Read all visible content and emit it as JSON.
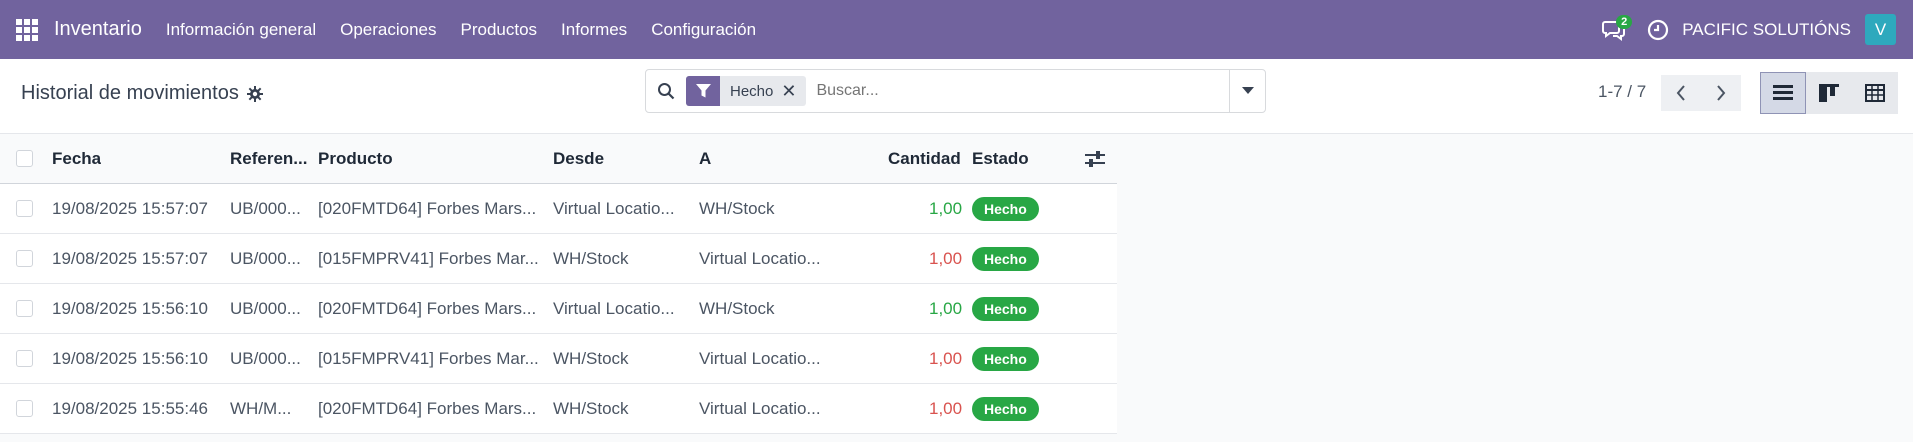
{
  "navbar": {
    "brand": "Inventario",
    "menu": [
      "Información general",
      "Operaciones",
      "Productos",
      "Informes",
      "Configuración"
    ],
    "chat_count": "2",
    "company": "PACIFIC SOLUTIÓNS",
    "avatar_letter": "V",
    "color": "#71639e"
  },
  "control": {
    "title": "Historial de movimientos",
    "facet_label": "Hecho",
    "facet_close": "✕",
    "search_placeholder": "Buscar...",
    "pager": "1-7 / 7"
  },
  "table": {
    "headers": {
      "fecha": "Fecha",
      "referencia": "Referen...",
      "producto": "Producto",
      "desde": "Desde",
      "a": "A",
      "cantidad": "Cantidad",
      "estado": "Estado"
    },
    "rows": [
      {
        "fecha": "19/08/2025 15:57:07",
        "referencia": "UB/000...",
        "producto": "[020FMTD64] Forbes Mars...",
        "desde": "Virtual Locatio...",
        "a": "WH/Stock",
        "cantidad": "1,00",
        "estado": "Hecho"
      },
      {
        "fecha": "19/08/2025 15:57:07",
        "referencia": "UB/000...",
        "producto": "[015FMPRV41] Forbes Mar...",
        "desde": "WH/Stock",
        "a": "Virtual Locatio...",
        "cantidad": "1,00",
        "estado": "Hecho"
      },
      {
        "fecha": "19/08/2025 15:56:10",
        "referencia": "UB/000...",
        "producto": "[020FMTD64] Forbes Mars...",
        "desde": "Virtual Locatio...",
        "a": "WH/Stock",
        "cantidad": "1,00",
        "estado": "Hecho"
      },
      {
        "fecha": "19/08/2025 15:56:10",
        "referencia": "UB/000...",
        "producto": "[015FMPRV41] Forbes Mar...",
        "desde": "WH/Stock",
        "a": "Virtual Locatio...",
        "cantidad": "1,00",
        "estado": "Hecho"
      },
      {
        "fecha": "19/08/2025 15:55:46",
        "referencia": "WH/M...",
        "producto": "[020FMTD64] Forbes Mars...",
        "desde": "WH/Stock",
        "a": "Virtual Locatio...",
        "cantidad": "1,00",
        "estado": "Hecho"
      }
    ],
    "colors": {
      "positive": "#28a745",
      "negative": "#d9534f",
      "badge": "#28a745"
    }
  }
}
